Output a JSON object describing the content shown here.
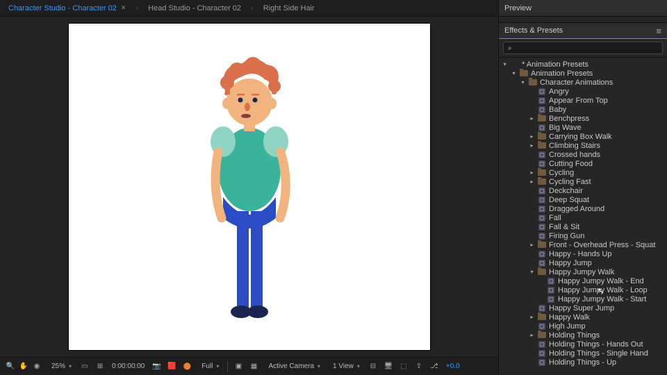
{
  "tabs": [
    {
      "label": "Character Studio - Character 02",
      "active": true
    },
    {
      "label": "Head Studio - Character 02",
      "active": false
    },
    {
      "label": "Right Side Hair",
      "active": false
    }
  ],
  "statusbar": {
    "zoom": "25%",
    "timecode": "0:00:00:00",
    "resolution": "Full",
    "camera": "Active Camera",
    "views": "1 View",
    "exposure": "+0.0"
  },
  "preview": {
    "title": "Preview"
  },
  "effects": {
    "title": "Effects & Presets",
    "search_placeholder": "⌕"
  },
  "tree": [
    {
      "depth": 0,
      "twisty": "down",
      "icon": "none",
      "label": "* Animation Presets"
    },
    {
      "depth": 1,
      "twisty": "down",
      "icon": "folder",
      "label": "Animation Presets"
    },
    {
      "depth": 2,
      "twisty": "down",
      "icon": "folder",
      "label": "Character Animations"
    },
    {
      "depth": 3,
      "twisty": "",
      "icon": "preset",
      "label": "Angry"
    },
    {
      "depth": 3,
      "twisty": "",
      "icon": "preset",
      "label": "Appear From Top"
    },
    {
      "depth": 3,
      "twisty": "",
      "icon": "preset",
      "label": "Baby"
    },
    {
      "depth": 3,
      "twisty": "right",
      "icon": "folder",
      "label": "Benchpress"
    },
    {
      "depth": 3,
      "twisty": "",
      "icon": "preset",
      "label": "Big Wave"
    },
    {
      "depth": 3,
      "twisty": "right",
      "icon": "folder",
      "label": "Carrying Box Walk"
    },
    {
      "depth": 3,
      "twisty": "right",
      "icon": "folder",
      "label": "Climbing Stairs"
    },
    {
      "depth": 3,
      "twisty": "",
      "icon": "preset",
      "label": "Crossed hands"
    },
    {
      "depth": 3,
      "twisty": "",
      "icon": "preset",
      "label": "Cutting Food"
    },
    {
      "depth": 3,
      "twisty": "right",
      "icon": "folder",
      "label": "Cycling"
    },
    {
      "depth": 3,
      "twisty": "right",
      "icon": "folder",
      "label": "Cycling Fast"
    },
    {
      "depth": 3,
      "twisty": "",
      "icon": "preset",
      "label": "Deckchair"
    },
    {
      "depth": 3,
      "twisty": "",
      "icon": "preset",
      "label": "Deep Squat"
    },
    {
      "depth": 3,
      "twisty": "",
      "icon": "preset",
      "label": "Dragged Around"
    },
    {
      "depth": 3,
      "twisty": "",
      "icon": "preset",
      "label": "Fall"
    },
    {
      "depth": 3,
      "twisty": "",
      "icon": "preset",
      "label": "Fall & Sit"
    },
    {
      "depth": 3,
      "twisty": "",
      "icon": "preset",
      "label": "Firing Gun"
    },
    {
      "depth": 3,
      "twisty": "right",
      "icon": "folder",
      "label": "Front - Overhead Press - Squat"
    },
    {
      "depth": 3,
      "twisty": "",
      "icon": "preset",
      "label": "Happy - Hands Up"
    },
    {
      "depth": 3,
      "twisty": "",
      "icon": "preset",
      "label": "Happy Jump"
    },
    {
      "depth": 3,
      "twisty": "down",
      "icon": "folder",
      "label": "Happy Jumpy Walk"
    },
    {
      "depth": 4,
      "twisty": "",
      "icon": "preset",
      "label": "Happy Jumpy Walk - End"
    },
    {
      "depth": 4,
      "twisty": "",
      "icon": "preset",
      "label": "Happy Jumpy Walk - Loop",
      "cursor": true
    },
    {
      "depth": 4,
      "twisty": "",
      "icon": "preset",
      "label": "Happy Jumpy Walk - Start"
    },
    {
      "depth": 3,
      "twisty": "",
      "icon": "preset",
      "label": "Happy Super Jump"
    },
    {
      "depth": 3,
      "twisty": "right",
      "icon": "folder",
      "label": "Happy Walk"
    },
    {
      "depth": 3,
      "twisty": "",
      "icon": "preset",
      "label": "High Jump"
    },
    {
      "depth": 3,
      "twisty": "right",
      "icon": "folder",
      "label": "Holding Things"
    },
    {
      "depth": 3,
      "twisty": "",
      "icon": "preset",
      "label": "Holding Things - Hands Out"
    },
    {
      "depth": 3,
      "twisty": "",
      "icon": "preset",
      "label": "Holding Things - Single Hand"
    },
    {
      "depth": 3,
      "twisty": "",
      "icon": "preset",
      "label": "Holding Things - Up"
    }
  ]
}
